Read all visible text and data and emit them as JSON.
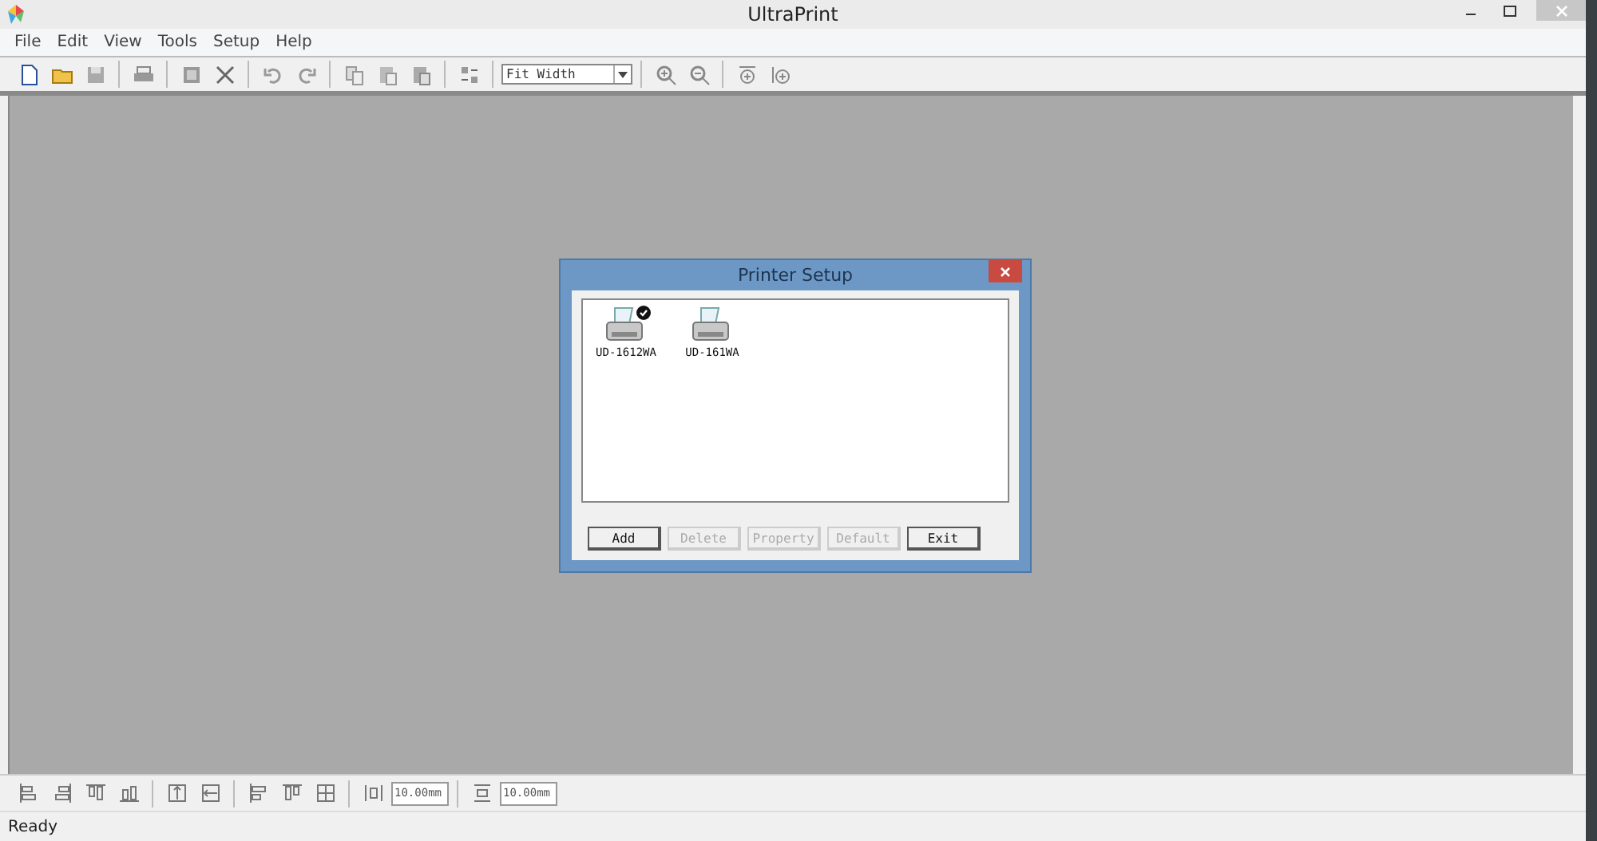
{
  "window": {
    "title": "UltraPrint"
  },
  "menu": [
    "File",
    "Edit",
    "View",
    "Tools",
    "Setup",
    "Help"
  ],
  "toolbar": {
    "zoom_select": {
      "value": "Fit Width"
    }
  },
  "dialog": {
    "title": "Printer Setup",
    "printers": [
      {
        "name": "UD-1612WA",
        "default": true
      },
      {
        "name": "UD-161WA",
        "default": false
      }
    ],
    "buttons": [
      {
        "label": "Add",
        "disabled": false
      },
      {
        "label": "Delete",
        "disabled": true
      },
      {
        "label": "Property",
        "disabled": true
      },
      {
        "label": "Default",
        "disabled": true
      },
      {
        "label": "Exit",
        "disabled": false
      }
    ]
  },
  "layout_toolbar": {
    "spacing_h": "10.00mm",
    "spacing_v": "10.00mm"
  },
  "status_bar": "Ready"
}
